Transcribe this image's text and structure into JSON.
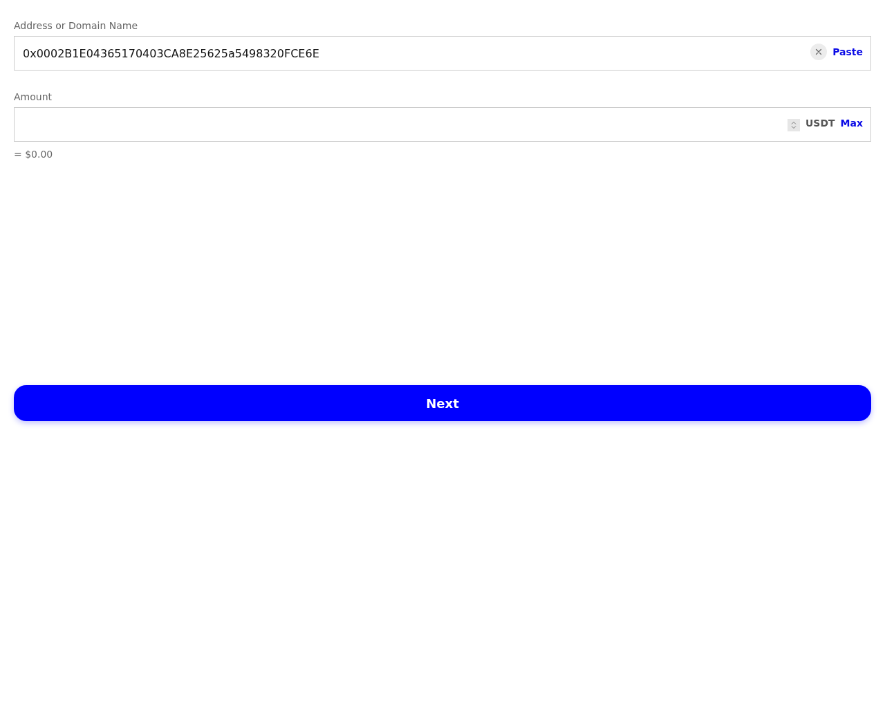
{
  "address": {
    "label": "Address or Domain Name",
    "value": "0x0002B1E04365170403CA8E25625a5498320FCE6E",
    "paste_button": "Paste"
  },
  "amount": {
    "label": "Amount",
    "currency": "USDT",
    "max_button": "Max",
    "fiat_value": "= $0.00"
  },
  "next_button": {
    "label": "Next"
  }
}
